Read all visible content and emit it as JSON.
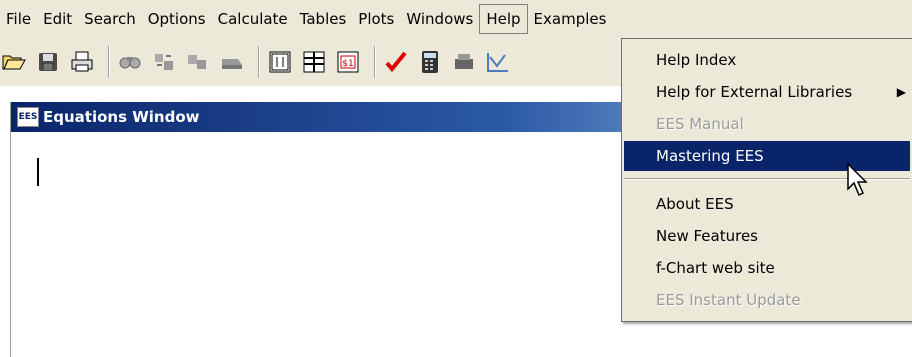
{
  "menubar": {
    "items": [
      "File",
      "Edit",
      "Search",
      "Options",
      "Calculate",
      "Tables",
      "Plots",
      "Windows",
      "Help",
      "Examples"
    ]
  },
  "toolbar": {
    "icons": [
      "open-folder-icon",
      "save-disk-icon",
      "print-icon",
      "find-icon",
      "replace-icon",
      "find-next-icon",
      "check-format-icon",
      "parametric-table-icon",
      "lookup-table-icon",
      "units-icon",
      "check-mark-icon",
      "calculator-icon",
      "printer-icon",
      "plot-icon"
    ]
  },
  "equations_window": {
    "title": "Equations Window",
    "icon_text": "EES"
  },
  "help_menu": {
    "items": [
      {
        "label": "Help Index",
        "enabled": true
      },
      {
        "label": "Help for External Libraries",
        "enabled": true,
        "submenu": true
      },
      {
        "label": "EES Manual",
        "enabled": false
      },
      {
        "label": "Mastering EES",
        "enabled": true,
        "selected": true
      },
      {
        "label": "About EES",
        "enabled": true
      },
      {
        "label": "New Features",
        "enabled": true
      },
      {
        "label": "f-Chart web site",
        "enabled": true
      },
      {
        "label": "EES Instant Update",
        "enabled": false
      }
    ],
    "submenu_arrow": "▶"
  },
  "colors": {
    "chrome": "#ece9d8",
    "selection": "#0a246a",
    "title_gradient_start": "#0a246a",
    "title_gradient_end": "#a6caf0",
    "check_red": "#e00000"
  }
}
